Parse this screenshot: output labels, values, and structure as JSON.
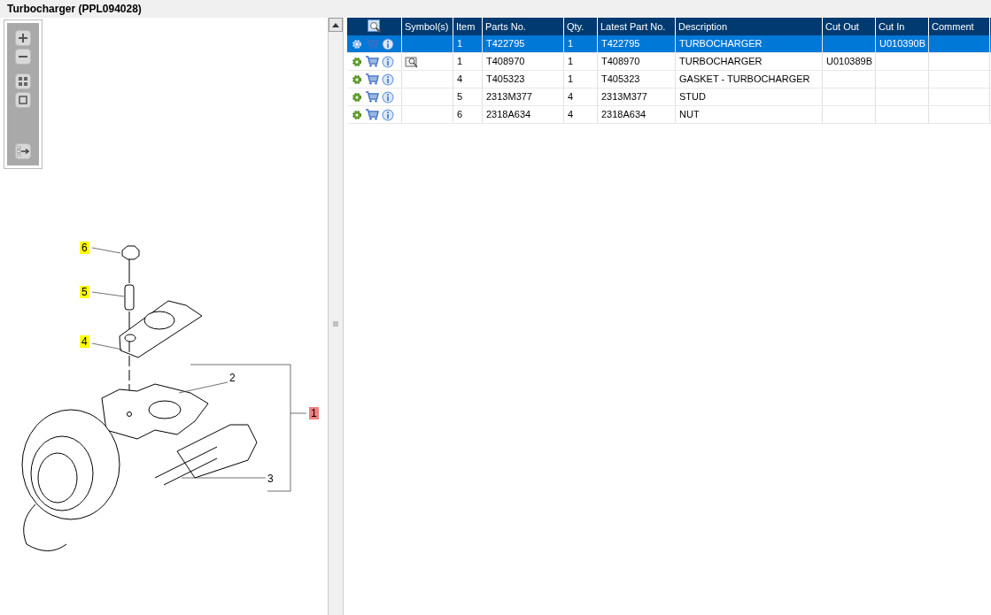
{
  "window": {
    "title": "Turbocharger (PPL094028)"
  },
  "callouts": [
    {
      "label": "6",
      "color": "#ffff00"
    },
    {
      "label": "5",
      "color": "#ffff00"
    },
    {
      "label": "4",
      "color": "#ffff00"
    },
    {
      "label": "2"
    },
    {
      "label": "1",
      "color": "#f08080"
    },
    {
      "label": "3"
    }
  ],
  "table": {
    "columns": [
      "Symbol(s)",
      "Item",
      "Parts No.",
      "Qty.",
      "Latest Part No.",
      "Description",
      "Cut Out",
      "Cut In",
      "Comment"
    ],
    "rows": [
      {
        "selected": true,
        "symbol": false,
        "cells": [
          "",
          "1",
          "T422795",
          "1",
          "T422795",
          "TURBOCHARGER",
          "",
          "U010390B",
          ""
        ]
      },
      {
        "selected": false,
        "symbol": true,
        "cells": [
          "",
          "1",
          "T408970",
          "1",
          "T408970",
          "TURBOCHARGER",
          "U010389B",
          "",
          ""
        ]
      },
      {
        "selected": false,
        "symbol": false,
        "cells": [
          "",
          "4",
          "T405323",
          "1",
          "T405323",
          "GASKET - TURBOCHARGER",
          "",
          "",
          ""
        ]
      },
      {
        "selected": false,
        "symbol": false,
        "cells": [
          "",
          "5",
          "2313M377",
          "4",
          "2313M377",
          "STUD",
          "",
          "",
          ""
        ]
      },
      {
        "selected": false,
        "symbol": false,
        "cells": [
          "",
          "6",
          "2318A634",
          "4",
          "2318A634",
          "NUT",
          "",
          "",
          ""
        ]
      }
    ]
  }
}
